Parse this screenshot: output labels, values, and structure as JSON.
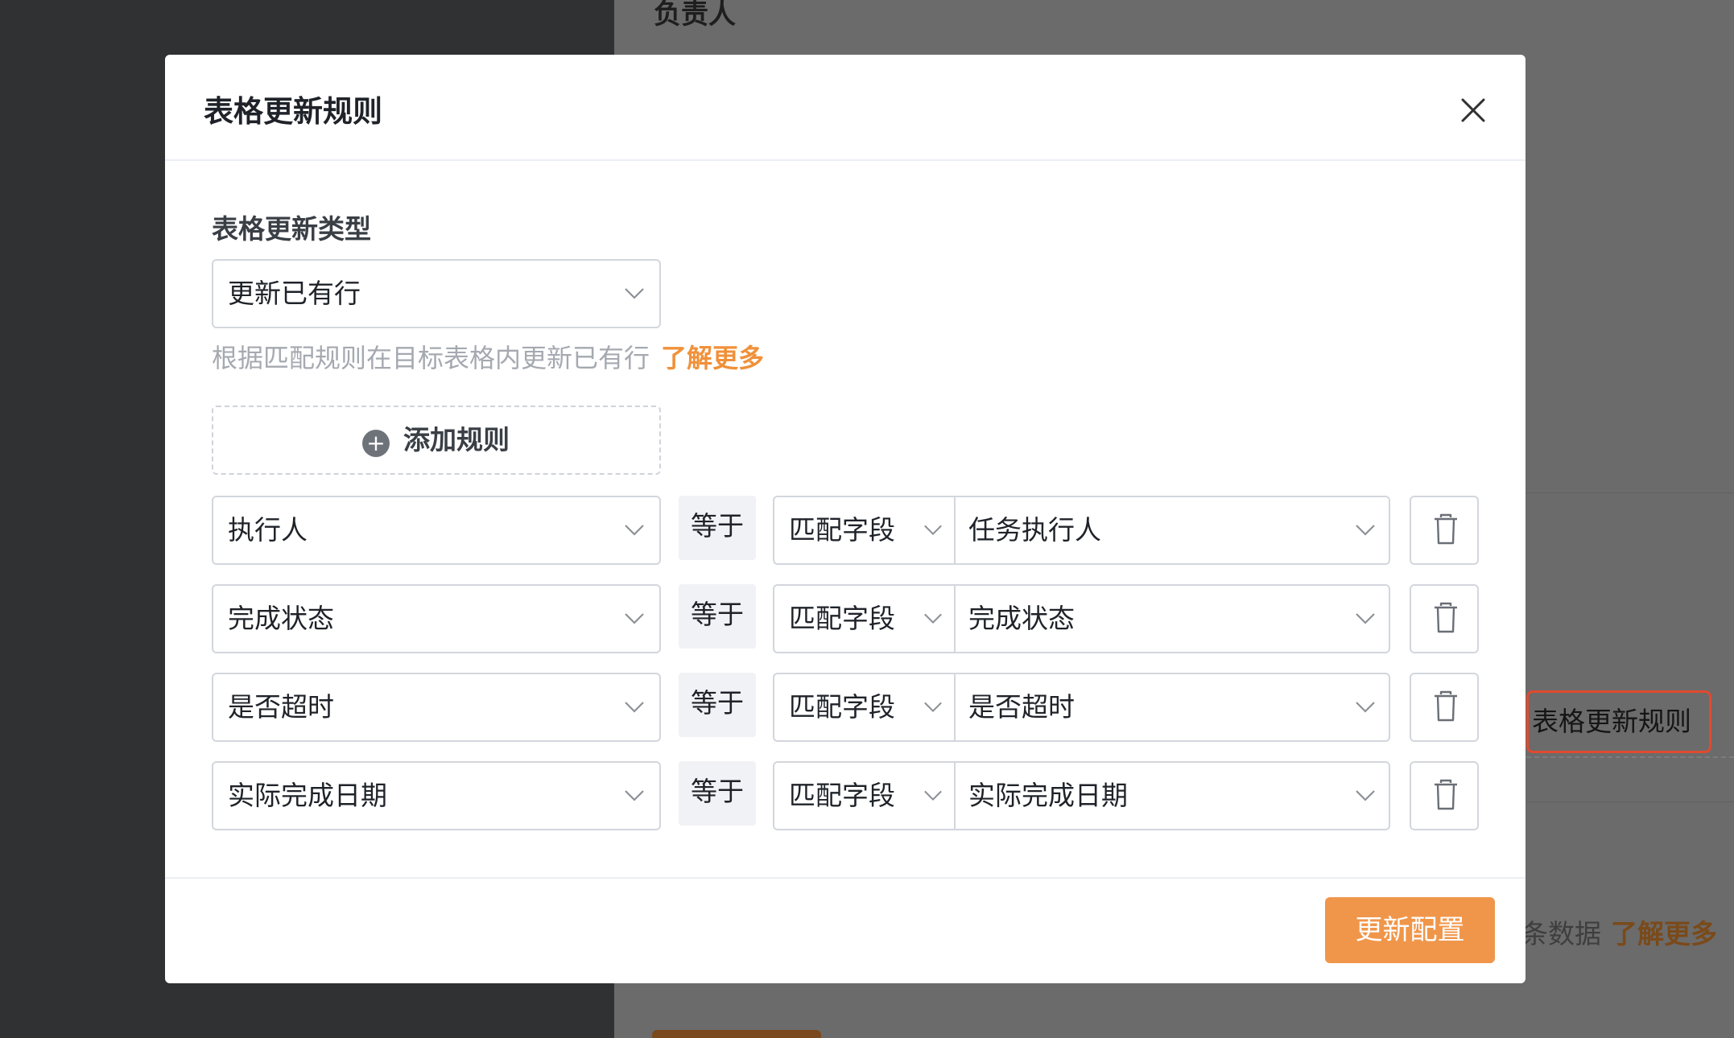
{
  "background": {
    "heading": "负责人",
    "chip_label": "表格更新规则",
    "hint_text": "条数据",
    "hint_link": "了解更多"
  },
  "modal": {
    "title": "表格更新规则",
    "update_type_label": "表格更新类型",
    "update_type_value": "更新已有行",
    "description": "根据匹配规则在目标表格内更新已有行",
    "learn_more": "了解更多",
    "add_rule_label": "添加规则",
    "rules": [
      {
        "field": "执行人",
        "operator": "等于",
        "match_type": "匹配字段",
        "match_value": "任务执行人"
      },
      {
        "field": "完成状态",
        "operator": "等于",
        "match_type": "匹配字段",
        "match_value": "完成状态"
      },
      {
        "field": "是否超时",
        "operator": "等于",
        "match_type": "匹配字段",
        "match_value": "是否超时"
      },
      {
        "field": "实际完成日期",
        "operator": "等于",
        "match_type": "匹配字段",
        "match_value": "实际完成日期"
      }
    ],
    "submit_label": "更新配置"
  },
  "icons": [
    "close-icon",
    "chevron-down-icon",
    "plus-circle-icon",
    "trash-icon"
  ],
  "colors": {
    "accent": "#f0964a",
    "link": "#f0913a",
    "overlay": "#303133"
  }
}
